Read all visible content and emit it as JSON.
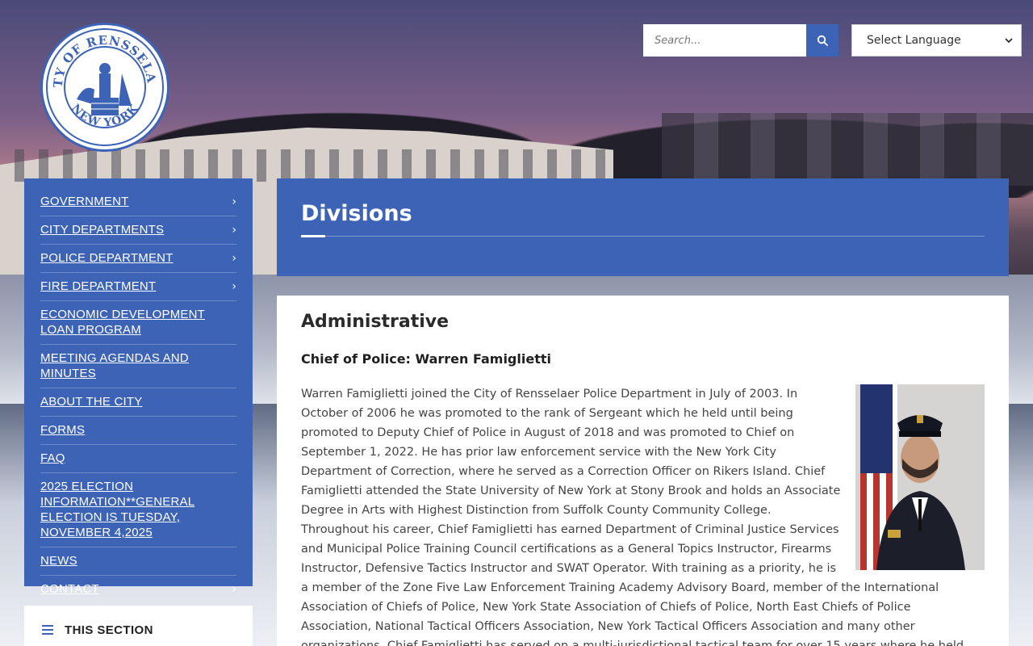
{
  "header": {
    "logo_alt": "City of Rensselaer New York seal",
    "logo_text_top": "CITY OF RENSSELAER",
    "logo_text_bottom": "NEW YORK",
    "search_placeholder": "Search...",
    "language_select": "Select Language"
  },
  "sidebar": {
    "items": [
      {
        "label": "GOVERNMENT",
        "has_children": true
      },
      {
        "label": "CITY DEPARTMENTS",
        "has_children": true
      },
      {
        "label": "POLICE DEPARTMENT",
        "has_children": true
      },
      {
        "label": "FIRE DEPARTMENT",
        "has_children": true
      },
      {
        "label": "ECONOMIC DEVELOPMENT LOAN PROGRAM",
        "has_children": false
      },
      {
        "label": "MEETING AGENDAS AND MINUTES",
        "has_children": false
      },
      {
        "label": "ABOUT THE CITY",
        "has_children": false
      },
      {
        "label": "FORMS",
        "has_children": false
      },
      {
        "label": "FAQ",
        "has_children": false
      },
      {
        "label": "2025 ELECTION INFORMATION**GENERAL ELECTION IS TUESDAY, NOVEMBER 4,2025",
        "has_children": false
      },
      {
        "label": "NEWS",
        "has_children": false
      },
      {
        "label": "CONTACT",
        "has_children": true
      }
    ],
    "this_section_label": "THIS SECTION"
  },
  "main": {
    "page_title": "Divisions",
    "section_heading": "Administrative",
    "chief_line": "Chief of Police:  Warren Famiglietti",
    "bio": "Warren Famiglietti joined the City of Rensselaer Police Department in July of 2003.  In October of 2006 he was promoted to the rank of Sergeant which he held until being promoted to Deputy Chief of Police in August of 2018 and was promoted to Chief on September 1, 2022.  He has prior law enforcement service with the New York City Department of Correction, where he served as a Correction Officer on Rikers Island.  Chief Famiglietti attended the State University of New York at Stony Brook and holds an Associate Degree in Arts with Highest Distinction from Suffolk County Community College.  Throughout his career,  Chief Famiglietti has earned Department of Criminal Justice Services and  Municipal Police Training Council certifications as a General Topics Instructor, Firearms Instructor, Defensive Tactics Instructor and SWAT Operator.  With training as a priority, he is a member of the Zone Five Law Enforcement Training Academy Advisory Board, member of the International Association of Chiefs of Police, New York State Association of Chiefs of Police, North East Chiefs of Police Association, National Tactical Officers Association, New York Tactical Officers Association and many other organizations.  Chief Famiglietti has served on a multi-jurisdictional tactical team for over 15 years where he held multiple titles including"
  },
  "icons": {
    "search": "search-icon",
    "chevron": "chevron-right-icon",
    "menu": "menu-icon"
  },
  "colors": {
    "brand_blue": "#3d63b6",
    "white": "#ffffff",
    "text": "#444444"
  }
}
